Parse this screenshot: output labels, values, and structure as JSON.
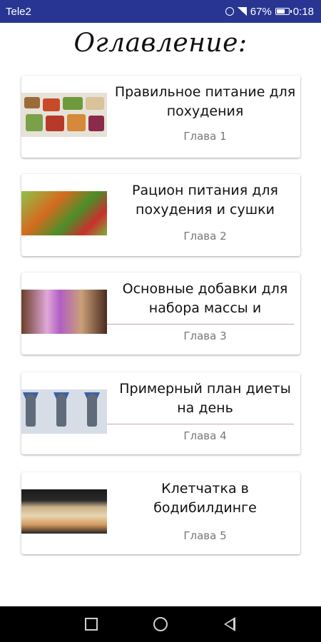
{
  "status_bar": {
    "carrier": "Tele2",
    "battery": "67%",
    "time": "0:18",
    "icons": [
      "alarm-icon",
      "signal-icon",
      "battery-icon"
    ]
  },
  "page": {
    "title": "Оглавление:"
  },
  "chapters": [
    {
      "title": "Правильное питание для похудения",
      "chapter": "Глава 1",
      "thumb": "meal-prep-thumbnail"
    },
    {
      "title": "Рацион питания для похудения и сушки",
      "chapter": "Глава 2",
      "thumb": "vegetables-thumbnail"
    },
    {
      "title": "Основные добавки для набора массы и",
      "chapter": "Глава 3",
      "thumb": "supplements-thumbnail"
    },
    {
      "title": "Примерный план диеты на день",
      "chapter": "Глава 4",
      "thumb": "bodybuilders-thumbnail"
    },
    {
      "title": "Клетчатка в бодибилдинге",
      "chapter": "Глава 5",
      "thumb": "buffet-thumbnail"
    }
  ],
  "nav_bar": {
    "buttons": [
      "recents-button",
      "home-button",
      "back-button"
    ]
  },
  "colors": {
    "status_bar": "#283593",
    "nav_bar": "#000000",
    "card_bg": "#ffffff",
    "chapter_text": "#777777",
    "accent_line": "#c9a5b5"
  }
}
